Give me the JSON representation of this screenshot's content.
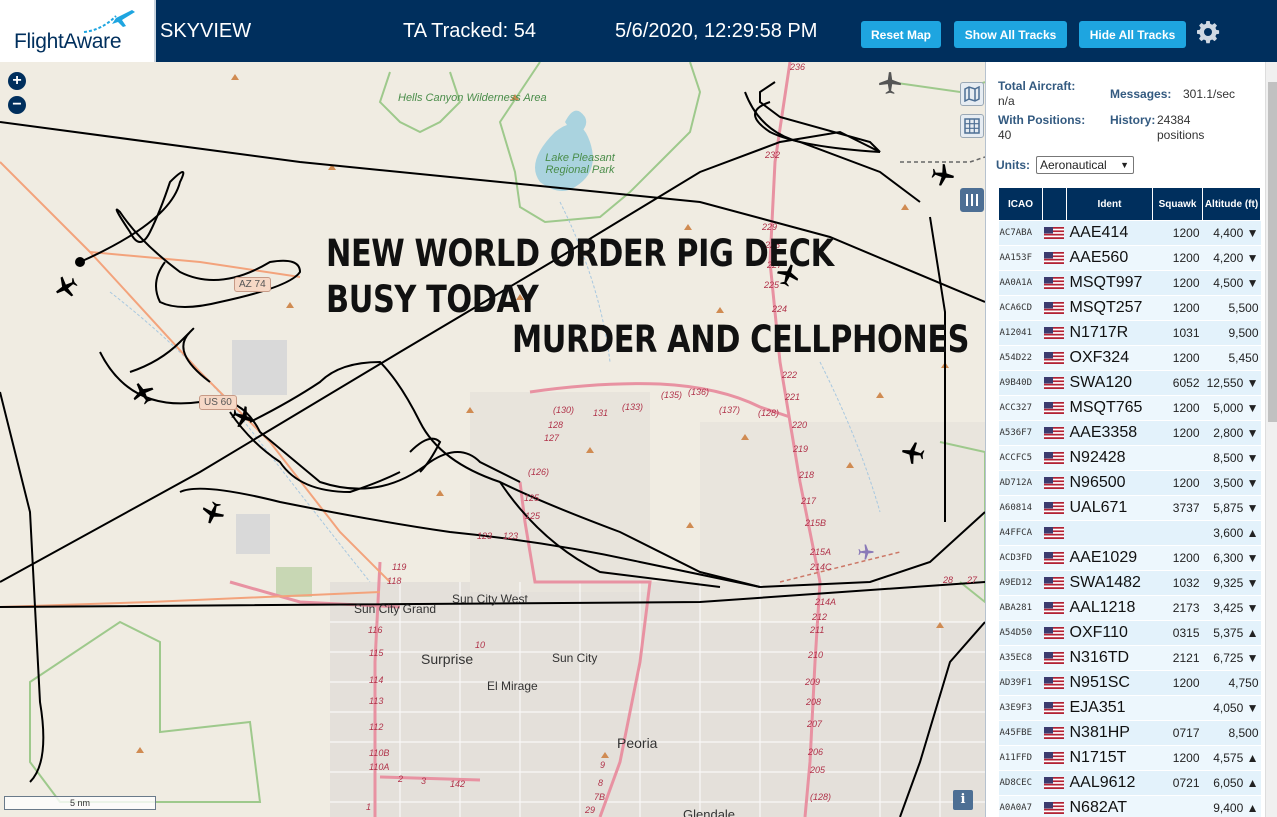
{
  "header": {
    "logo": "FlightAware",
    "app_name": "SKYVIEW",
    "tracked_label": "TA Tracked: 54",
    "datetime": "5/6/2020, 12:29:58 PM",
    "buttons": {
      "reset_map": "Reset Map",
      "show_all_tracks": "Show All Tracks",
      "hide_all_tracks": "Hide All Tracks"
    },
    "settings_icon": "gear-icon"
  },
  "map": {
    "overlay_text": [
      "NEW WORLD ORDER PIG DECK",
      "BUSY TODAY",
      "MURDER AND CELLPHONES"
    ],
    "zoom_in": "+",
    "zoom_out": "−",
    "scale": "5 nm",
    "info": "i",
    "places": {
      "sun_city_grand": "Sun City Grand",
      "sun_city_west": "Sun City West",
      "surprise": "Surprise",
      "sun_city": "Sun City",
      "el_mirage": "El Mirage",
      "peoria": "Peoria",
      "glendale": "Glendale"
    },
    "parks": {
      "hells_canyon": "Hells Canyon Wilderness Area",
      "lake_pleasant": "Lake Pleasant Regional Park"
    },
    "shields": {
      "az74": "AZ 74",
      "us60": "US 60"
    },
    "route_labels": [
      "236",
      "232",
      "229",
      "228",
      "227",
      "225",
      "224",
      "222",
      "221",
      "220",
      "219",
      "218",
      "217",
      "215B",
      "215A",
      "214C",
      "214A",
      "212",
      "211",
      "210",
      "209",
      "208",
      "207",
      "206",
      "205",
      "(128)",
      "(130)",
      "131",
      "(133)",
      "(135)",
      "(136)",
      "(137)",
      "(128)",
      "128",
      "127",
      "(126)",
      "125",
      "125",
      "123",
      "123",
      "119",
      "118",
      "116",
      "115",
      "114",
      "113",
      "112",
      "110B",
      "110A",
      "1",
      "2",
      "3",
      "142",
      "10",
      "9",
      "8",
      "7B",
      "29",
      "28",
      "27"
    ],
    "colors": {
      "land": "#f0ece2",
      "park_border": "#9ec98c",
      "lake": "#aad3df",
      "highway": "#e892a2",
      "track": "#000000"
    }
  },
  "sidebar": {
    "total_aircraft_label": "Total Aircraft:",
    "total_aircraft_value": "n/a",
    "messages_label": "Messages:",
    "messages_value": "301.1/sec",
    "with_positions_label": "With Positions:",
    "with_positions_value": "40",
    "history_label": "History:",
    "history_value": "24384 positions",
    "units_label": "Units:",
    "units_value": "Aeronautical",
    "columns": [
      "ICAO",
      "",
      "Ident",
      "Squawk",
      "Altitude (ft)"
    ],
    "rows": [
      {
        "icao": "AC7ABA",
        "ident": "AAE414",
        "squawk": "1200",
        "alt": "4,400 ▼"
      },
      {
        "icao": "AA153F",
        "ident": "AAE560",
        "squawk": "1200",
        "alt": "4,200 ▼"
      },
      {
        "icao": "AA0A1A",
        "ident": "MSQT997",
        "squawk": "1200",
        "alt": "4,500 ▼"
      },
      {
        "icao": "ACA6CD",
        "ident": "MSQT257",
        "squawk": "1200",
        "alt": "5,500"
      },
      {
        "icao": "A12041",
        "ident": "N1717R",
        "squawk": "1031",
        "alt": "9,500"
      },
      {
        "icao": "A54D22",
        "ident": "OXF324",
        "squawk": "1200",
        "alt": "5,450"
      },
      {
        "icao": "A9B40D",
        "ident": "SWA120",
        "squawk": "6052",
        "alt": "12,550 ▼"
      },
      {
        "icao": "ACC327",
        "ident": "MSQT765",
        "squawk": "1200",
        "alt": "5,000 ▼"
      },
      {
        "icao": "A536F7",
        "ident": "AAE3358",
        "squawk": "1200",
        "alt": "2,800 ▼"
      },
      {
        "icao": "ACCFC5",
        "ident": "N92428",
        "squawk": "",
        "alt": "8,500 ▼"
      },
      {
        "icao": "AD712A",
        "ident": "N96500",
        "squawk": "1200",
        "alt": "3,500 ▼"
      },
      {
        "icao": "A60814",
        "ident": "UAL671",
        "squawk": "3737",
        "alt": "5,875 ▼"
      },
      {
        "icao": "A4FFCA",
        "ident": "",
        "squawk": "",
        "alt": "3,600 ▲"
      },
      {
        "icao": "ACD3FD",
        "ident": "AAE1029",
        "squawk": "1200",
        "alt": "6,300 ▼"
      },
      {
        "icao": "A9ED12",
        "ident": "SWA1482",
        "squawk": "1032",
        "alt": "9,325 ▼"
      },
      {
        "icao": "ABA281",
        "ident": "AAL1218",
        "squawk": "2173",
        "alt": "3,425 ▼"
      },
      {
        "icao": "A54D50",
        "ident": "OXF110",
        "squawk": "0315",
        "alt": "5,375 ▲"
      },
      {
        "icao": "A35EC8",
        "ident": "N316TD",
        "squawk": "2121",
        "alt": "6,725 ▼"
      },
      {
        "icao": "AD39F1",
        "ident": "N951SC",
        "squawk": "1200",
        "alt": "4,750"
      },
      {
        "icao": "A3E9F3",
        "ident": "EJA351",
        "squawk": "",
        "alt": "4,050 ▼"
      },
      {
        "icao": "A45FBE",
        "ident": "N381HP",
        "squawk": "0717",
        "alt": "8,500"
      },
      {
        "icao": "A11FFD",
        "ident": "N1715T",
        "squawk": "1200",
        "alt": "4,575 ▲"
      },
      {
        "icao": "AD8CEC",
        "ident": "AAL9612",
        "squawk": "0721",
        "alt": "6,050 ▲"
      },
      {
        "icao": "A0A0A7",
        "ident": "N682AT",
        "squawk": "",
        "alt": "9,400 ▲"
      }
    ]
  }
}
